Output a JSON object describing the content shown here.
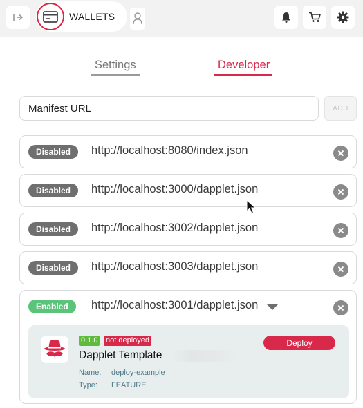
{
  "header": {
    "wallets_label": "WALLETS",
    "icons": [
      "collapse-icon",
      "wallet-card-icon",
      "person-icon",
      "bell-icon",
      "cart-icon",
      "gear-icon"
    ]
  },
  "tabs": [
    {
      "label": "Settings",
      "active": false
    },
    {
      "label": "Developer",
      "active": true
    }
  ],
  "manifest": {
    "placeholder": "Manifest URL",
    "add_label": "ADD"
  },
  "registries": [
    {
      "status": "Disabled",
      "url": "http://localhost:8080/index.json"
    },
    {
      "status": "Disabled",
      "url": "http://localhost:3000/dapplet.json"
    },
    {
      "status": "Disabled",
      "url": "http://localhost:3002/dapplet.json"
    },
    {
      "status": "Disabled",
      "url": "http://localhost:3003/dapplet.json"
    },
    {
      "status": "Enabled",
      "url": "http://localhost:3001/dapplet.json"
    }
  ],
  "dapplet": {
    "version": "0.1.0",
    "deploy_status": "not deployed",
    "title": "Dapplet Template",
    "name_label": "Name:",
    "name_value": "deploy-example",
    "type_label": "Type:",
    "type_value": "FEATURE",
    "deploy_label": "Deploy"
  },
  "colors": {
    "accent": "#d9294b",
    "enabled": "#5cc47a",
    "disabled": "#6f6f6f",
    "version_badge": "#5fbb3c",
    "card_bg": "#e8eeee"
  }
}
